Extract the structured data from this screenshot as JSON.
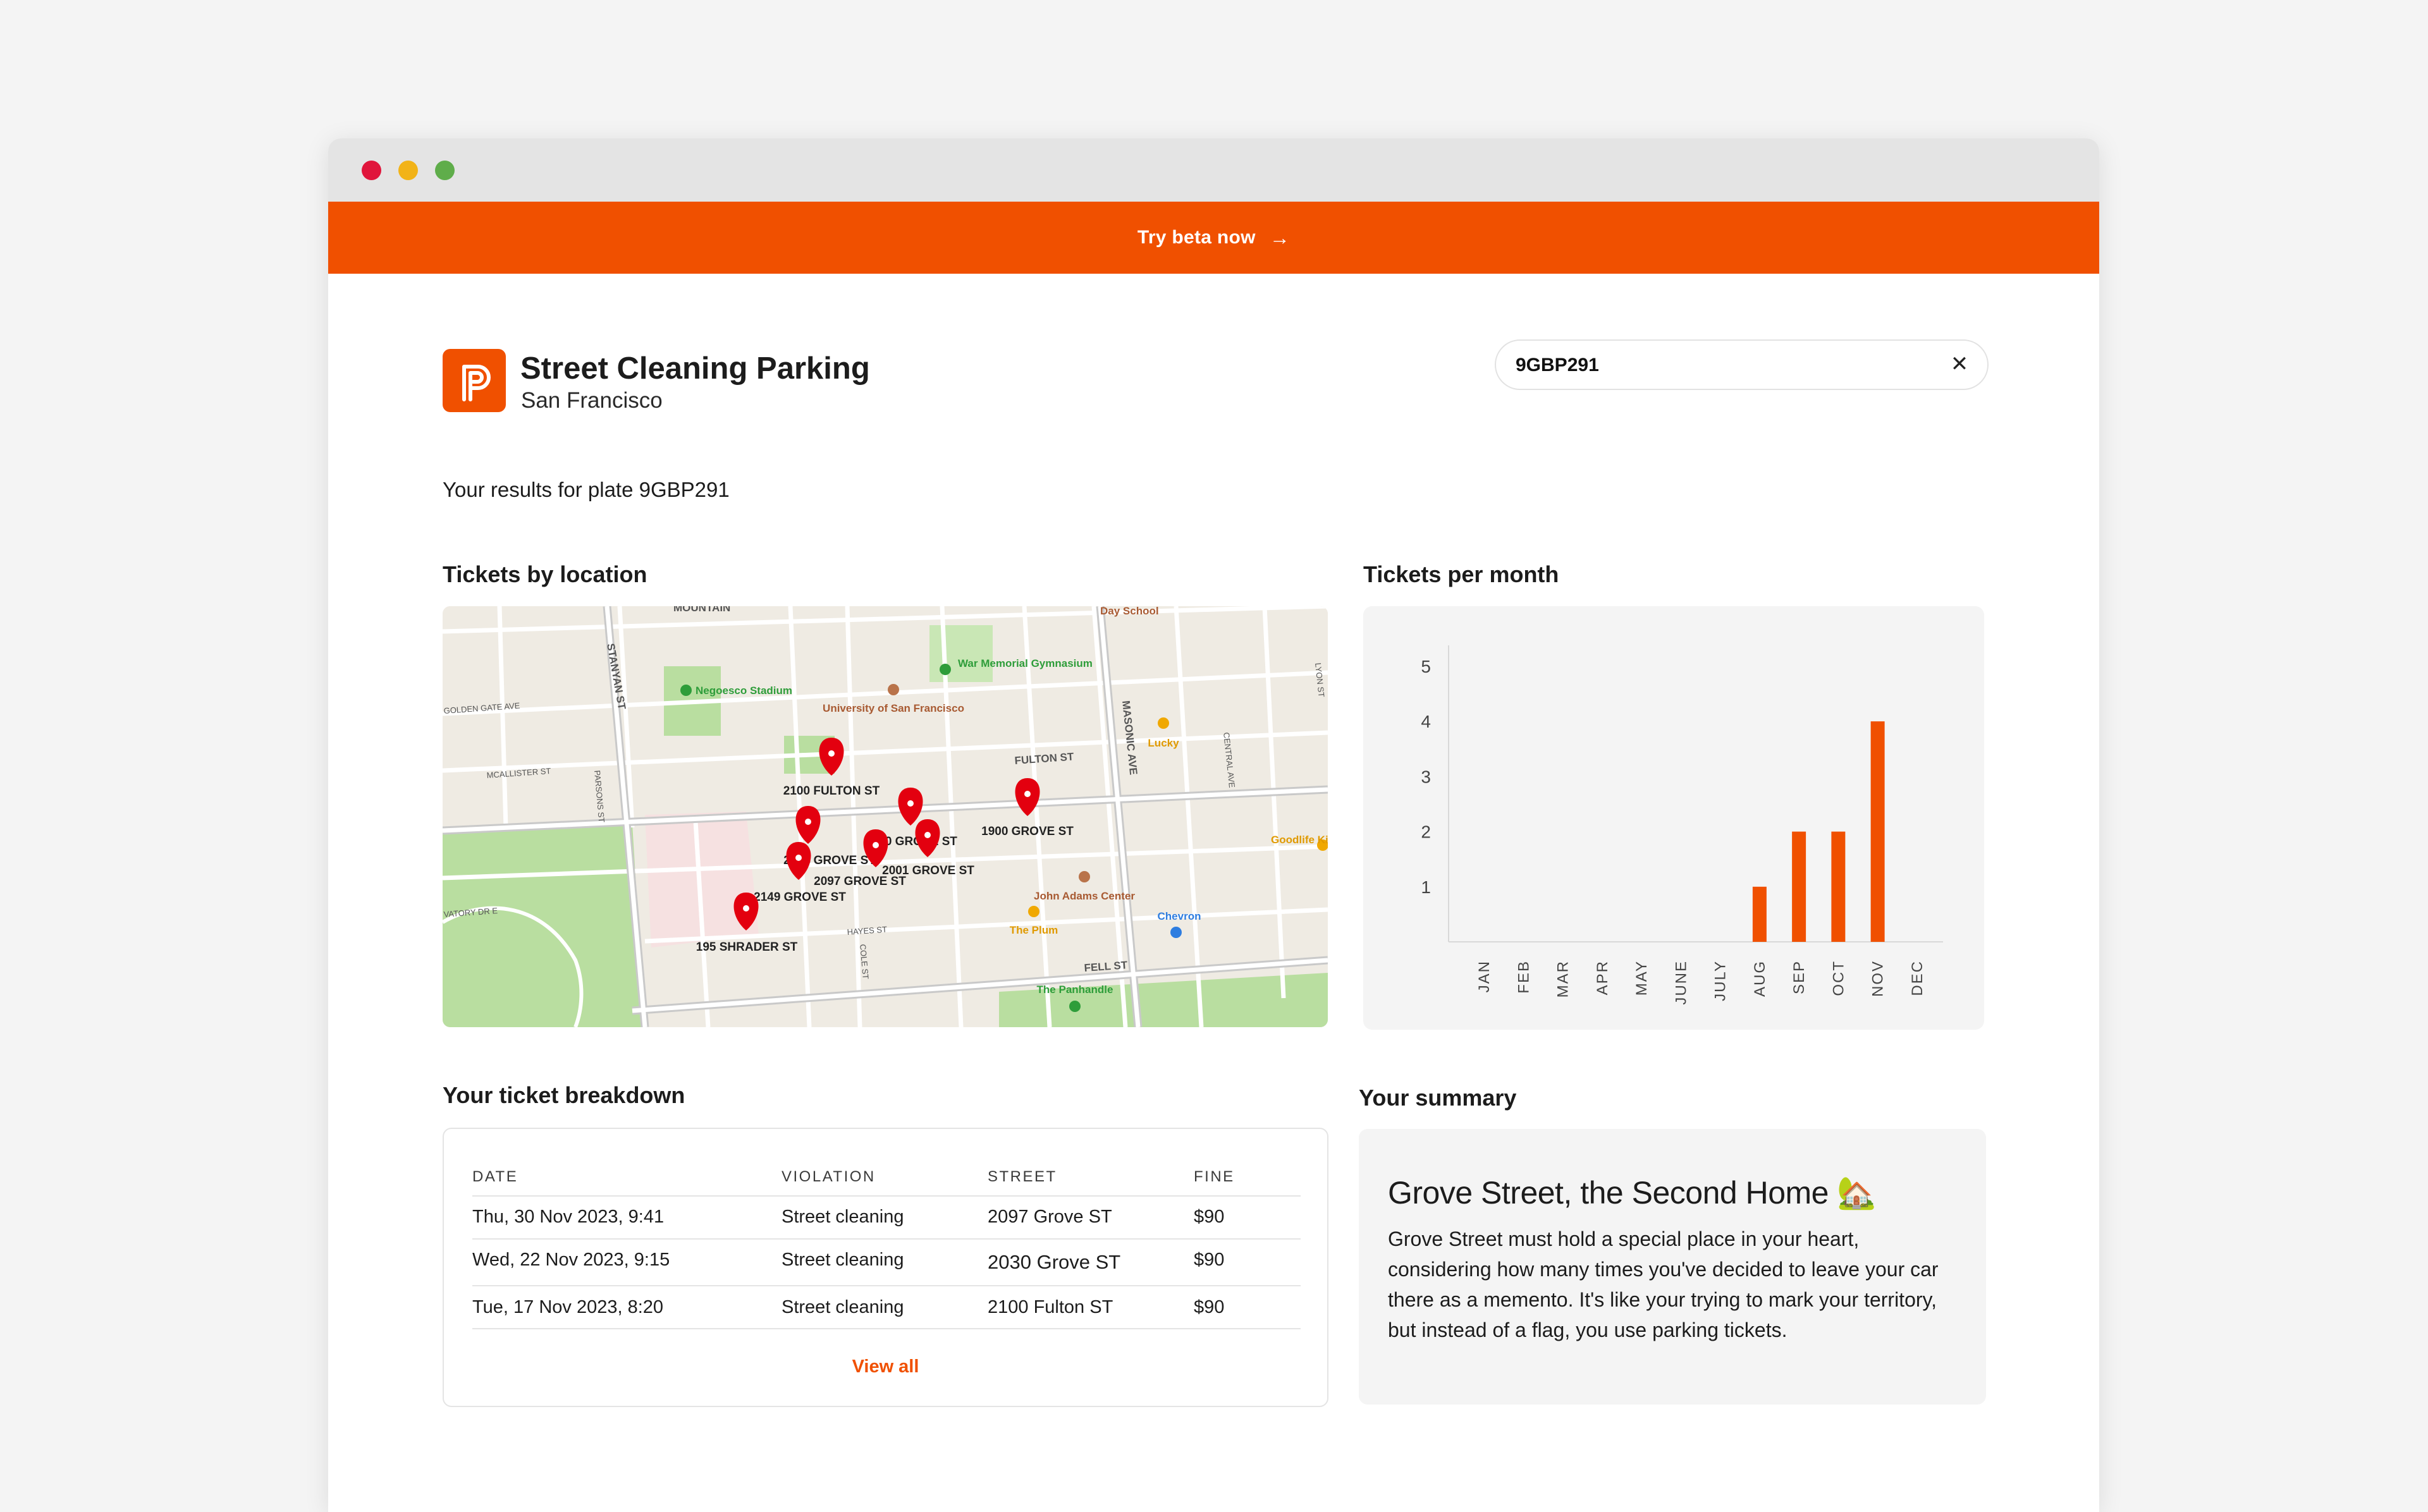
{
  "banner": {
    "label": "Try beta now",
    "arrow_icon": "arrow-right-icon"
  },
  "header": {
    "logo_icon": "parking-p-icon",
    "title": "Street Cleaning Parking",
    "subtitle": "San Francisco"
  },
  "search": {
    "value": "9GBP291",
    "clear_icon": "close-icon"
  },
  "results_text": "Your results for plate 9GBP291",
  "map_section": {
    "title": "Tickets by location",
    "street_labels": [
      "MOUNTAIN",
      "STANYAN ST",
      "FULTON ST",
      "MASONIC AVE",
      "MCALLISTER ST",
      "GOLDEN GATE AVE",
      "PARSONS ST",
      "CENTRAL AVE",
      "LYON ST",
      "HAYES ST",
      "COLE ST",
      "FELL ST",
      "VATORY DR E"
    ],
    "poi_labels": [
      "Negoesco Stadium",
      "War Memorial Gymnasium",
      "University of San Francisco",
      "Lucky",
      "Goodlife Kitchens",
      "John Adams Center",
      "The Plum",
      "Chevron",
      "The Panhandle",
      "Day School"
    ],
    "pins": [
      "2100 FULTON ST",
      "2030 GROVE ST",
      "1900 GROVE ST",
      "2134 GROVE ST",
      "2097 GROVE ST",
      "2001 GROVE ST",
      "2149 GROVE ST",
      "195 SHRADER ST"
    ]
  },
  "chart_section": {
    "title": "Tickets per month",
    "chart_data": {
      "type": "bar",
      "categories": [
        "JAN",
        "FEB",
        "MAR",
        "APR",
        "MAY",
        "JUNE",
        "JULY",
        "AUG",
        "SEP",
        "OCT",
        "NOV",
        "DEC"
      ],
      "values": [
        0,
        0,
        0,
        0,
        0,
        0,
        0,
        1,
        2,
        2,
        4,
        0
      ],
      "ylim": [
        0,
        5
      ],
      "yticks": [
        1,
        2,
        3,
        4,
        5
      ],
      "bar_color": "#f05000",
      "grid": false
    }
  },
  "breakdown": {
    "title": "Your ticket breakdown",
    "headers": [
      "DATE",
      "VIOLATION",
      "STREET",
      "FINE"
    ],
    "rows": [
      [
        "Thu, 30 Nov 2023, 9:41",
        "Street cleaning",
        "2097 Grove ST",
        "$90"
      ],
      [
        "Wed, 22 Nov 2023, 9:15",
        "Street cleaning",
        "2030 Grove ST",
        "$90"
      ],
      [
        "Tue, 17 Nov 2023, 8:20",
        "Street cleaning",
        "2100 Fulton ST",
        "$90"
      ]
    ],
    "view_all": "View all"
  },
  "summary": {
    "title": "Your summary",
    "heading": "Grove Street, the Second Home 🏡",
    "body": "Grove Street must hold a special place in your heart, considering how many times you've decided to leave your car there as a memento. It's like your trying to mark your territory, but instead of a flag, you use parking tickets."
  },
  "colors": {
    "accent": "#f05000",
    "pin": "#e3000f",
    "park": "#b9dea0"
  }
}
